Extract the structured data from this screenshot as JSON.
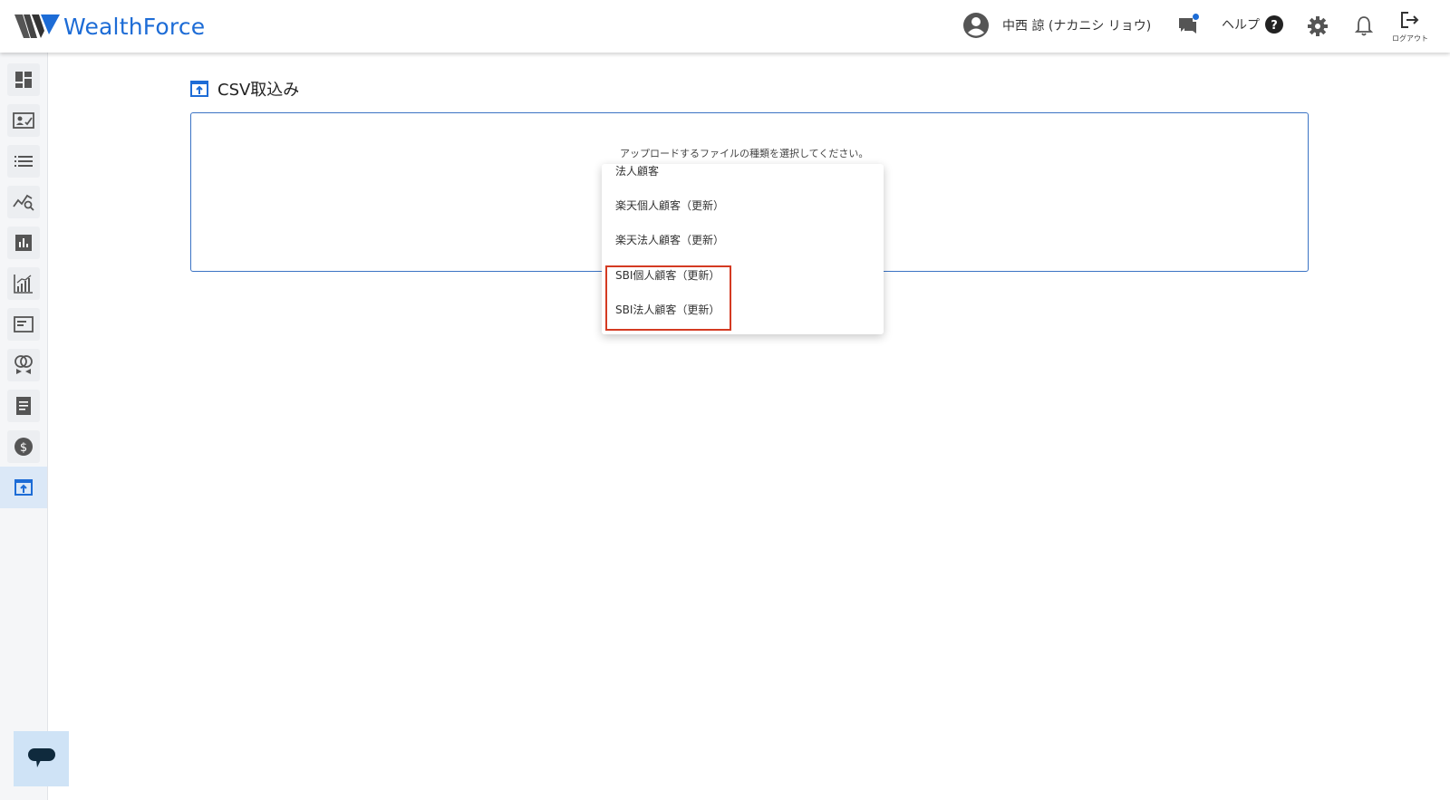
{
  "brand": {
    "name": "WealthForce",
    "color": "#1d6cd6"
  },
  "header": {
    "user_icon": "account-circle-icon",
    "user_name": "中西 諒 (ナカニシ リョウ)",
    "chat_icon": "chat-notification-icon",
    "help_label": "ヘルプ",
    "help_icon": "question-circle-icon",
    "settings_icon": "gear-icon",
    "notifications_icon": "bell-icon",
    "logout_label": "ログアウト",
    "logout_icon": "logout-icon"
  },
  "sidebar": {
    "items": [
      {
        "icon": "dashboard-icon"
      },
      {
        "icon": "customer-card-icon"
      },
      {
        "icon": "list-icon"
      },
      {
        "icon": "analysis-search-icon"
      },
      {
        "icon": "bar-report-icon"
      },
      {
        "icon": "growth-chart-icon"
      },
      {
        "icon": "message-card-icon"
      },
      {
        "icon": "rings-icon"
      },
      {
        "icon": "document-icon"
      },
      {
        "icon": "dollar-coin-icon"
      },
      {
        "icon": "csv-upload-icon",
        "active": true
      }
    ]
  },
  "main": {
    "title": "CSV取込み",
    "title_icon": "csv-upload-icon",
    "instruction": "アップロードするファイルの種類を選択してください。",
    "dropdown_options": [
      "法人顧客",
      "楽天個人顧客（更新）",
      "楽天法人顧客（更新）",
      "SBI個人顧客（更新）",
      "SBI法人顧客（更新）"
    ],
    "highlight_color": "#d43a22"
  },
  "chat_fab": {
    "icon": "chat-bubble-icon"
  }
}
